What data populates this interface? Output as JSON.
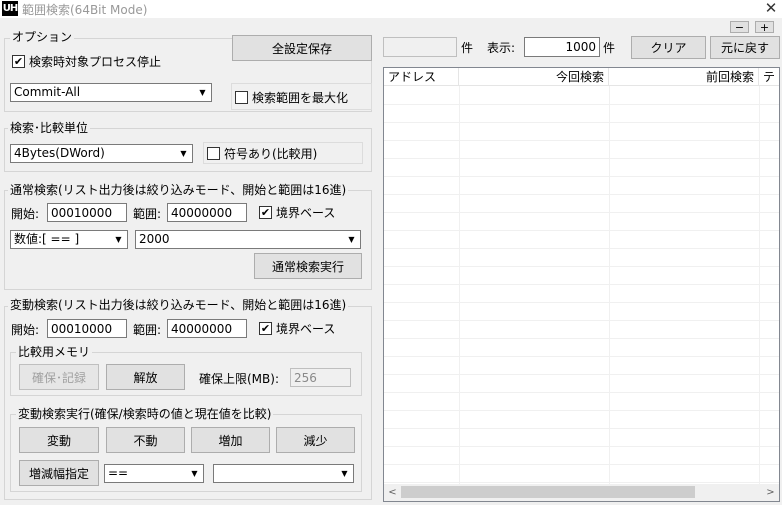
{
  "window": {
    "icon_text": "UH",
    "title": "範囲検索(64Bit Mode)",
    "close_glyph": "✕"
  },
  "options": {
    "group_label": "オプション",
    "stop_process_label": "検索時対象プロセス停止",
    "stop_process_checked": true,
    "memory_type": "Commit-All",
    "maximize_range_label": "検索範囲を最大化",
    "maximize_range_checked": false,
    "save_all_button": "全設定保存"
  },
  "unit": {
    "group_label": "検索･比較単位",
    "type": "4Bytes(DWord)",
    "signed_label": "符号あり(比較用)",
    "signed_checked": false
  },
  "normal": {
    "group_label": "通常検索(リスト出力後は絞り込みモード、開始と範囲は16進)",
    "start_label": "開始:",
    "start_value": "00010000",
    "range_label": "範囲:",
    "range_value": "40000000",
    "boundary_label": "境界ベース",
    "boundary_checked": true,
    "condition": "数値:[ == ]",
    "value": "2000",
    "run_button": "通常検索実行"
  },
  "variable": {
    "group_label": "変動検索(リスト出力後は絞り込みモード、開始と範囲は16進)",
    "start_label": "開始:",
    "start_value": "00010000",
    "range_label": "範囲:",
    "range_value": "40000000",
    "boundary_label": "境界ベース",
    "boundary_checked": true,
    "memory": {
      "group_label": "比較用メモリ",
      "reserve_button": "確保･記録",
      "release_button": "解放",
      "limit_label": "確保上限(MB):",
      "limit_value": "256"
    },
    "exec": {
      "group_label": "変動検索実行(確保/検索時の値と現在値を比較)",
      "changed_button": "変動",
      "unchanged_button": "不動",
      "increased_button": "増加",
      "decreased_button": "減少",
      "delta_button": "増減幅指定",
      "delta_operator": "==",
      "delta_value": ""
    }
  },
  "results": {
    "count_value": "",
    "count_unit": "件",
    "display_label": "表示:",
    "display_value": "1000",
    "display_unit": "件",
    "clear_button": "クリア",
    "restore_button": "元に戻す",
    "minus_button": "−",
    "plus_button": "+",
    "columns": [
      "アドレス",
      "今回検索",
      "前回検索",
      "テ"
    ],
    "scroll_left": "<",
    "scroll_right": ">"
  },
  "glyphs": {
    "check": "✔",
    "dropdown": "▼"
  }
}
